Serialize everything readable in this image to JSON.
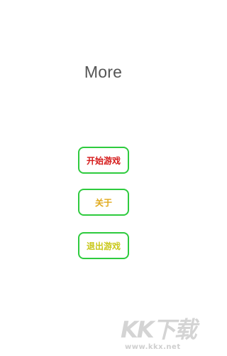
{
  "screen": {
    "title": "More"
  },
  "menu": {
    "items": [
      {
        "label": "开始游戏",
        "color": "#d51a1a"
      },
      {
        "label": "关于",
        "color": "#e0a91b"
      },
      {
        "label": "退出游戏",
        "color": "#c9c81a"
      }
    ],
    "border_color": "#2ecb3e"
  },
  "watermark": {
    "logo": "KK下载",
    "url": "www.kkx.net"
  }
}
